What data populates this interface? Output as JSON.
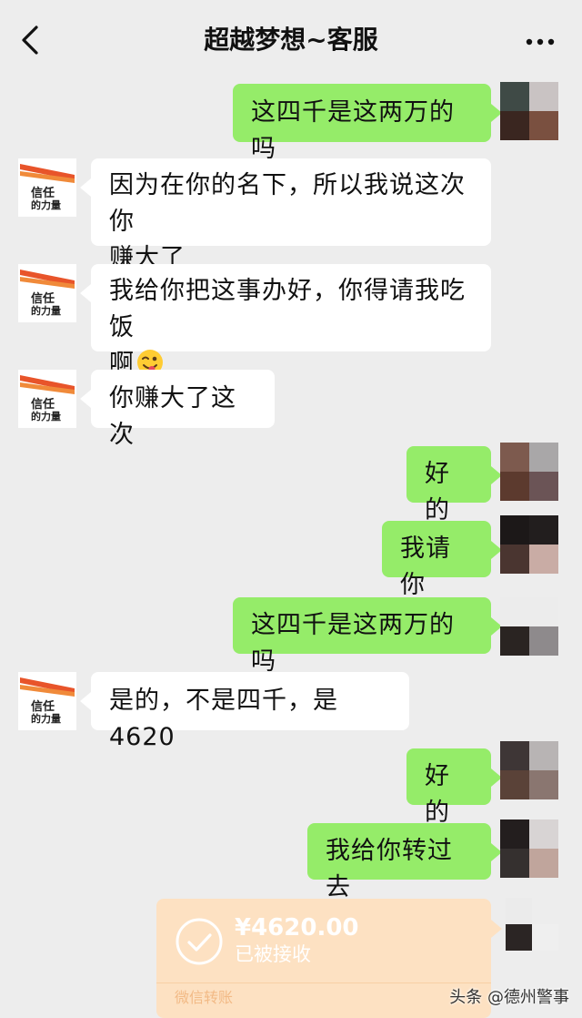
{
  "header": {
    "title": "超越梦想~客服",
    "back_icon": "chevron-left-icon",
    "more_icon": "more-dots-icon"
  },
  "brand_avatar": {
    "text_line1": "信任",
    "text_line2": "的力量"
  },
  "messages": [
    {
      "side": "out",
      "text": "这四千是这两万的吗"
    },
    {
      "side": "in",
      "text": "因为在你的名下，所以我说这次你赚大了"
    },
    {
      "side": "in",
      "text": "我给你把这事办好，你得请我吃饭啊",
      "emoji": "wink-tongue-emoji"
    },
    {
      "side": "in",
      "text": "你赚大了这次"
    },
    {
      "side": "out",
      "text": "好的"
    },
    {
      "side": "out",
      "text": "我请你"
    },
    {
      "side": "out",
      "text": "这四千是这两万的吗"
    },
    {
      "side": "in",
      "text": "是的，不是四千，是 4620"
    },
    {
      "side": "out",
      "text": "好的"
    },
    {
      "side": "out",
      "text": "我给你转过去"
    }
  ],
  "msg_line": {
    "m1a": "因为在你的名下，所以我说这次你",
    "m1b": "赚大了",
    "m2a": "我给你把这事办好，你得请我吃饭",
    "m2b": "啊"
  },
  "transfer": {
    "amount": "¥4620.00",
    "status": "已被接收",
    "label": "微信转账",
    "icon": "check-circle-icon"
  },
  "watermark": "头条 @德州警事",
  "colors": {
    "background": "#ededed",
    "outgoing_bubble": "#95ec69",
    "incoming_bubble": "#ffffff",
    "transfer_bubble": "#fde1c2"
  }
}
